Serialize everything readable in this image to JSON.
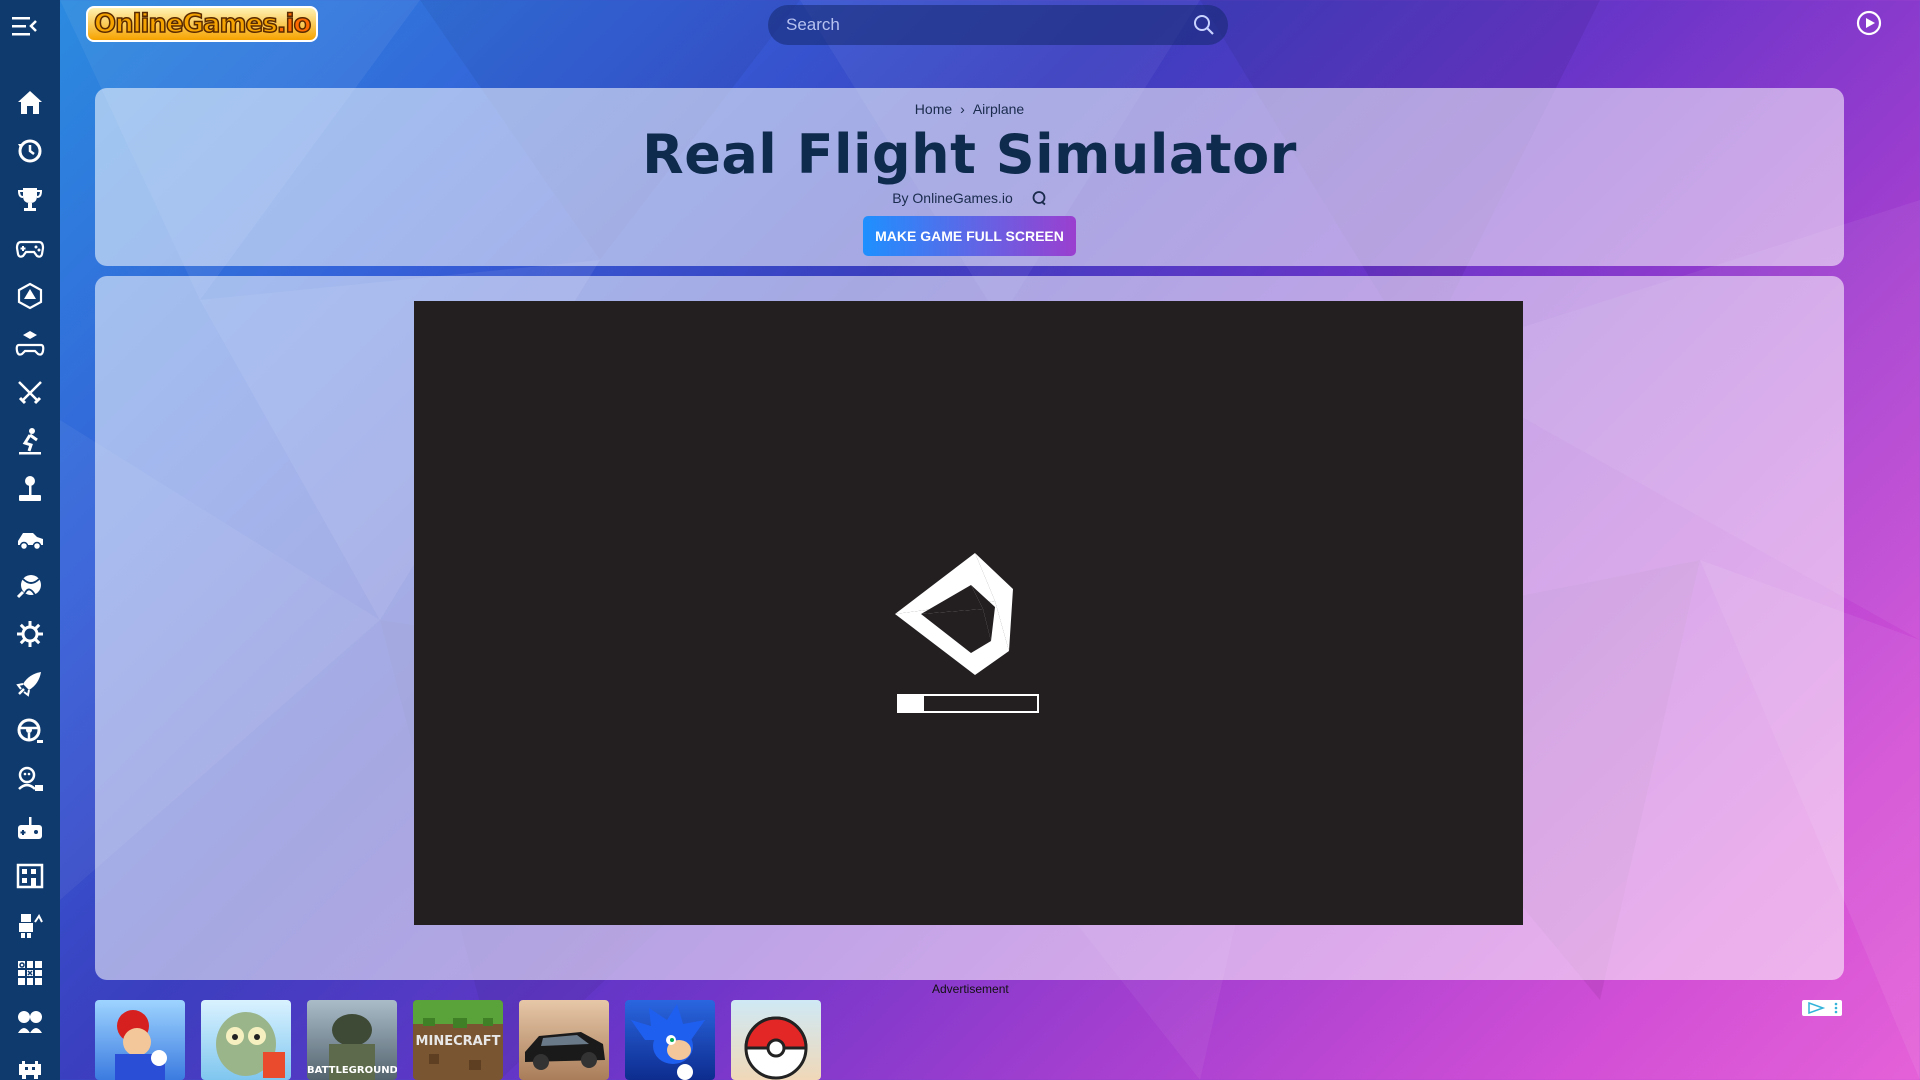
{
  "colors": {
    "sidebar_bg": "#0e3a6e",
    "title_color": "#0e2a4d",
    "button_gradient_start": "#1e90ff",
    "button_gradient_end": "#9b3fcf",
    "game_bg": "#231f20"
  },
  "header": {
    "logo_text": "OnlineGames",
    "logo_suffix": ".io",
    "search_placeholder": "Search"
  },
  "sidebar": {
    "icons": [
      "home-icon",
      "history-icon",
      "trophy-icon",
      "gamepad-icon",
      "dice-icon",
      "puzzle-cube-icon",
      "swords-icon",
      "skater-icon",
      "joystick-icon",
      "racing-icon",
      "ball-icon",
      "gear-icon",
      "rocket-icon",
      "steering-wheel-icon",
      "puzzle-face-icon",
      "controller-icon",
      "building-icon",
      "robot-icon",
      "tictactoe-icon",
      "duo-icon",
      "space-invader-icon"
    ]
  },
  "breadcrumb": {
    "home": "Home",
    "separator": "›",
    "category": "Airplane"
  },
  "game": {
    "title": "Real Flight Simulator",
    "byline": "By OnlineGames.io",
    "fullscreen_label": "MAKE GAME FULL SCREEN",
    "loading_progress": 0.18
  },
  "ads": {
    "label": "Advertisement",
    "tiles": [
      {
        "name": "mario",
        "caption": ""
      },
      {
        "name": "zombie",
        "caption": ""
      },
      {
        "name": "pubg",
        "caption": "BATTLEGROUNDS"
      },
      {
        "name": "minecraft",
        "caption": "MINECRAFT"
      },
      {
        "name": "car",
        "caption": ""
      },
      {
        "name": "sonic",
        "caption": ""
      },
      {
        "name": "pokeball",
        "caption": ""
      }
    ]
  }
}
